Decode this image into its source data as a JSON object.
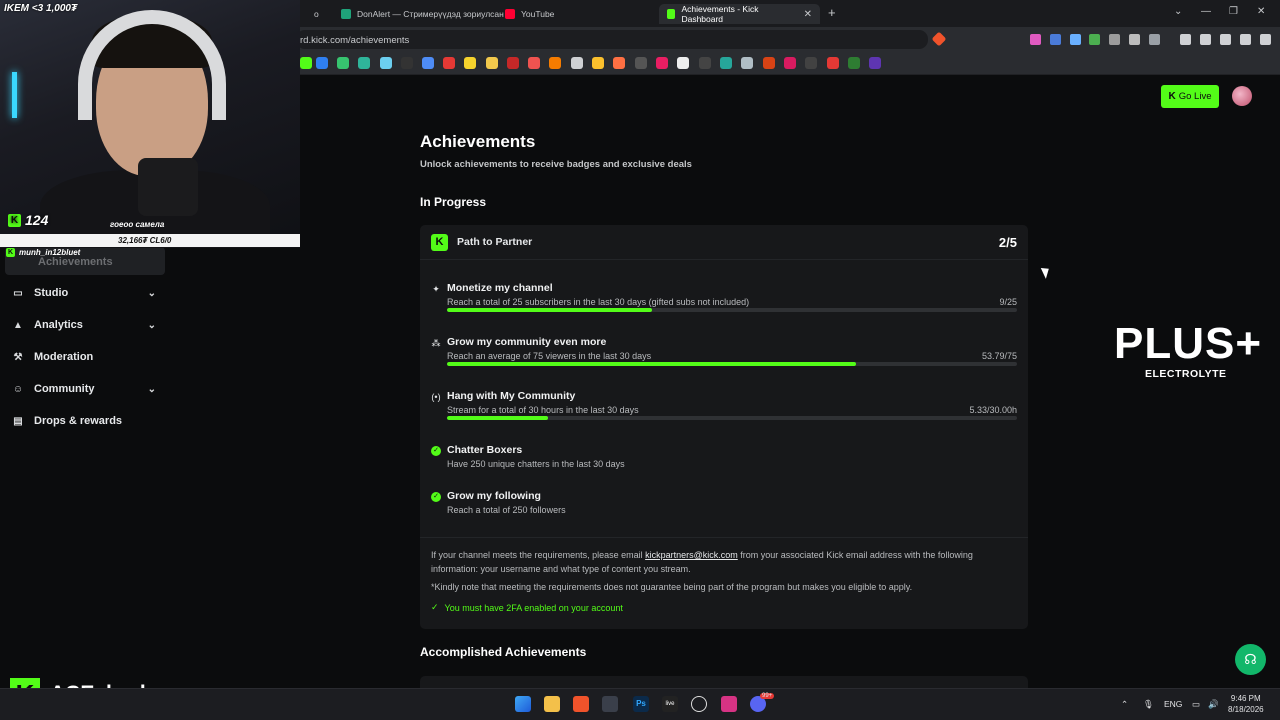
{
  "browser": {
    "tabs": [
      {
        "label": "DonAlert — Стримерүүдэд зориулсан",
        "favicon_color": "#1fa37a",
        "active": false
      },
      {
        "label": "YouTube",
        "favicon_color": "#ff0033",
        "active": false
      },
      {
        "label": "Achievements - Kick Dashboard",
        "favicon_color": "#53fc18",
        "active": true
      }
    ],
    "url": "rd.kick.com/achievements"
  },
  "sidebar": {
    "selected_label": "Achievements",
    "items": [
      {
        "label": "Studio",
        "icon": "studio-icon",
        "chevron": true
      },
      {
        "label": "Analytics",
        "icon": "analytics-icon",
        "chevron": true
      },
      {
        "label": "Moderation",
        "icon": "wrench-icon",
        "chevron": false
      },
      {
        "label": "Community",
        "icon": "community-icon",
        "chevron": true
      },
      {
        "label": "Drops & rewards",
        "icon": "drops-icon",
        "chevron": false
      }
    ]
  },
  "header": {
    "go_live_label": "Go Live"
  },
  "main": {
    "title": "Achievements",
    "subtitle": "Unlock achievements to receive badges and exclusive deals",
    "in_progress_heading": "In Progress",
    "accomplished_heading": "Accomplished Achievements",
    "card": {
      "title": "Path to Partner",
      "count": "2/5",
      "goals": [
        {
          "title": "Monetize my channel",
          "desc": "Reach a total of 25 subscribers in the last 30 days (gifted subs not included)",
          "value": "9/25",
          "progress": 0.36,
          "icon": "sparkle-icon",
          "done": false
        },
        {
          "title": "Grow my community even more",
          "desc": "Reach an average of 75 viewers in the last 30 days",
          "value": "53.79/75",
          "progress": 0.717,
          "icon": "people-icon",
          "done": false
        },
        {
          "title": "Hang with My Community",
          "desc": "Stream for a total of 30 hours in the last 30 days",
          "value": "5.33/30.00h",
          "progress": 0.178,
          "icon": "broadcast-icon",
          "done": false
        },
        {
          "title": "Chatter Boxers",
          "desc": "Have 250 unique chatters in the last 30 days",
          "value": "",
          "progress": null,
          "icon": "check-circle-icon",
          "done": true
        },
        {
          "title": "Grow my following",
          "desc": "Reach a total of 250 followers",
          "value": "",
          "progress": null,
          "icon": "check-circle-icon",
          "done": true
        }
      ],
      "footer": {
        "text_before_email": "If your channel meets the requirements, please email ",
        "email": "kickpartners@kick.com",
        "text_after_email": " from your associated Kick email address with the following information: your username and what type of content you stream.",
        "note": "*Kindly note that meeting the requirements does not guarantee being part of the program but makes you eligible to apply.",
        "requirement": "You must have 2FA enabled on your account"
      }
    }
  },
  "overlay": {
    "plus_logo_big": "PLUS+",
    "plus_logo_small": "ELECTROLYTE",
    "cam_topleft": "IKEM <3 1,000₮",
    "cam_count": "124",
    "cam_caption": "гоеоо самела",
    "cam_bar_text": "32,166₮ CL6/0",
    "cam_user": "munh_in12bluet",
    "brand_name": "ACE_bruh"
  },
  "taskbar": {
    "lang": "ENG",
    "time": "9:46 PM",
    "date": "8/18/2026",
    "discord_badge": "99+"
  },
  "colors": {
    "accent": "#53fc18",
    "background": "#0b0c0d",
    "card": "#17181a"
  }
}
